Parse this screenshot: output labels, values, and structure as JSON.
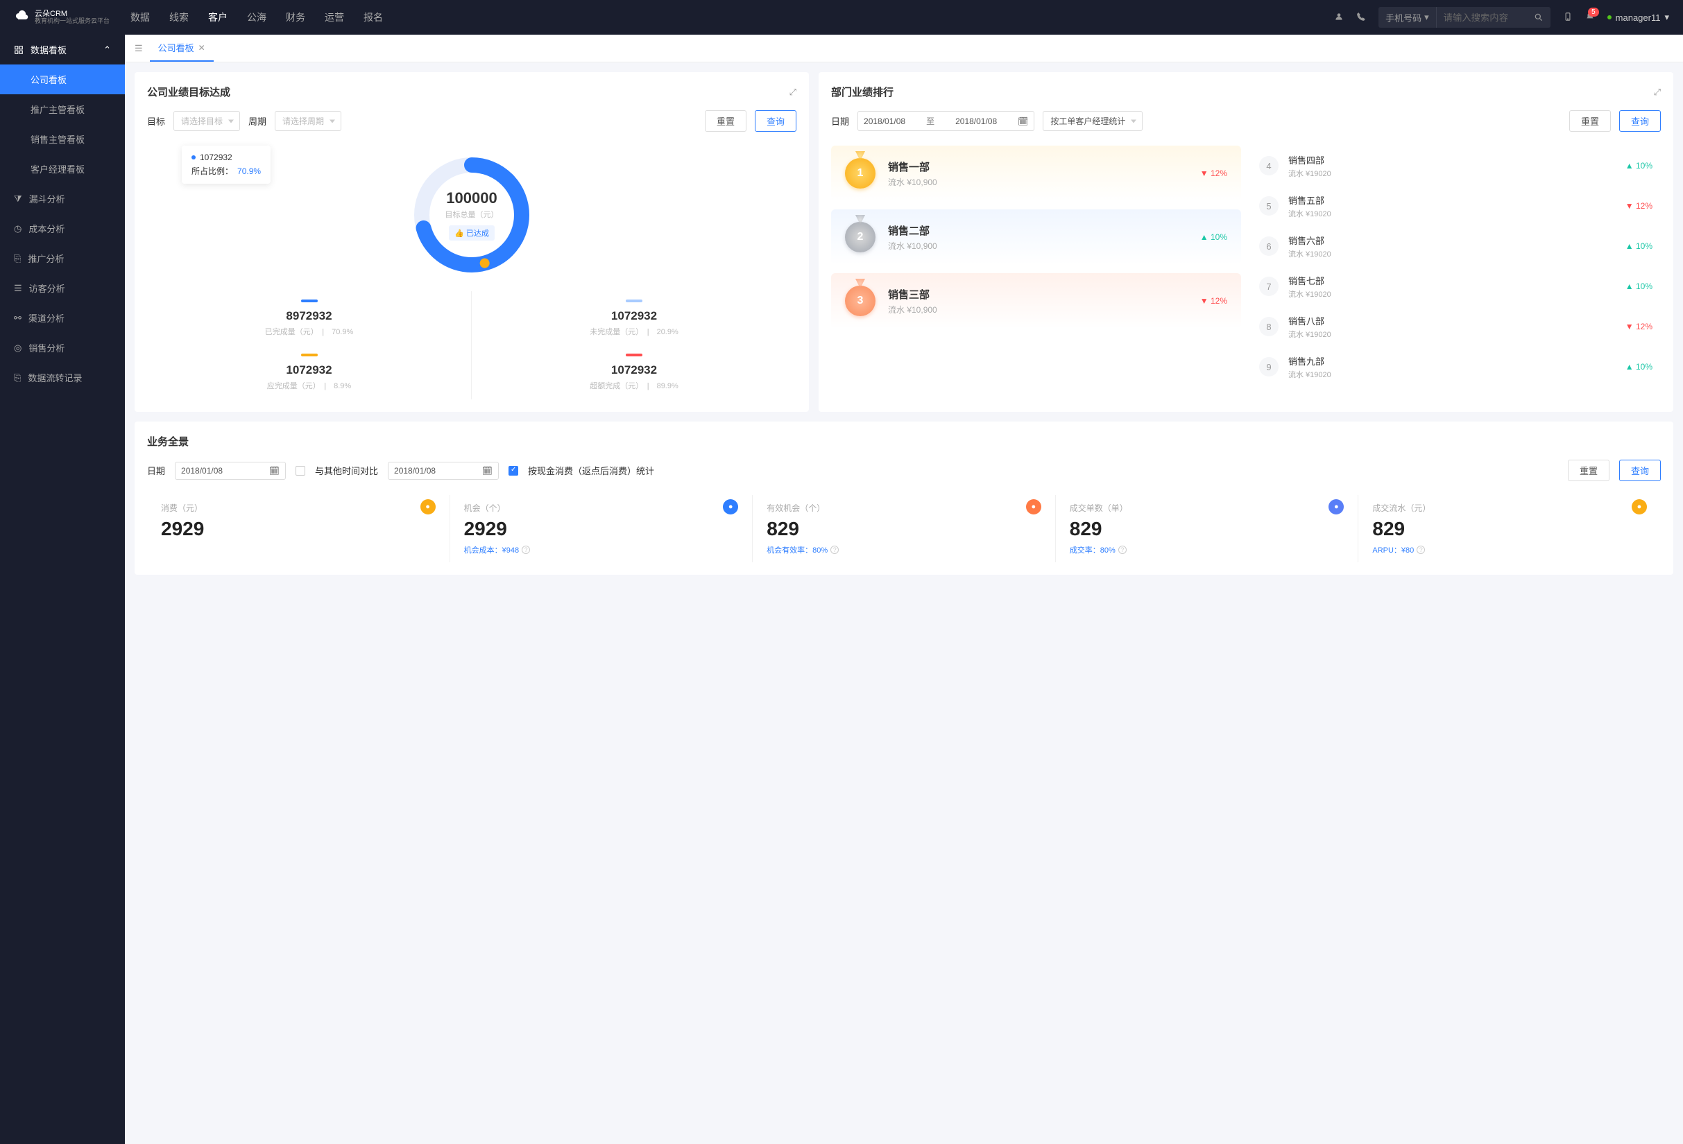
{
  "brand": {
    "name": "云朵CRM",
    "sub": "教育机构一站式服务云平台"
  },
  "topnav": {
    "items": [
      "数据",
      "线索",
      "客户",
      "公海",
      "财务",
      "运营",
      "报名"
    ],
    "active_index": 2
  },
  "search": {
    "type": "手机号码",
    "placeholder": "请输入搜索内容"
  },
  "notify_count": "5",
  "user": "manager11",
  "sidebar": {
    "group": "数据看板",
    "subs": [
      "公司看板",
      "推广主管看板",
      "销售主管看板",
      "客户经理看板"
    ],
    "active_sub": 0,
    "items": [
      "漏斗分析",
      "成本分析",
      "推广分析",
      "访客分析",
      "渠道分析",
      "销售分析",
      "数据流转记录"
    ]
  },
  "tab": {
    "title": "公司看板"
  },
  "goal": {
    "title": "公司业绩目标达成",
    "target_label": "目标",
    "target_placeholder": "请选择目标",
    "period_label": "周期",
    "period_placeholder": "请选择周期",
    "reset": "重置",
    "query": "查询",
    "center_value": "100000",
    "center_label": "目标总量（元）",
    "tag": "已达成",
    "tooltip_value": "1072932",
    "tooltip_label": "所占比例：",
    "tooltip_pct": "70.9%",
    "metrics": [
      {
        "bar": "#2e7eff",
        "val": "8972932",
        "label": "已完成量（元）",
        "pct": "70.9%"
      },
      {
        "bar": "#a8cbff",
        "val": "1072932",
        "label": "未完成量（元）",
        "pct": "20.9%"
      },
      {
        "bar": "#faad14",
        "val": "1072932",
        "label": "应完成量（元）",
        "pct": "8.9%"
      },
      {
        "bar": "#ff4d4f",
        "val": "1072932",
        "label": "超额完成（元）",
        "pct": "89.9%"
      }
    ]
  },
  "rank": {
    "title": "部门业绩排行",
    "date_label": "日期",
    "date_from": "2018/01/08",
    "date_sep": "至",
    "date_to": "2018/01/08",
    "mode": "按工单客户经理统计",
    "reset": "重置",
    "query": "查询",
    "top": [
      {
        "name": "销售一部",
        "sub": "流水 ¥10,900",
        "pct": "12%",
        "dir": "down"
      },
      {
        "name": "销售二部",
        "sub": "流水 ¥10,900",
        "pct": "10%",
        "dir": "up"
      },
      {
        "name": "销售三部",
        "sub": "流水 ¥10,900",
        "pct": "12%",
        "dir": "down"
      }
    ],
    "rest": [
      {
        "n": "4",
        "name": "销售四部",
        "sub": "流水 ¥19020",
        "pct": "10%",
        "dir": "up"
      },
      {
        "n": "5",
        "name": "销售五部",
        "sub": "流水 ¥19020",
        "pct": "12%",
        "dir": "down"
      },
      {
        "n": "6",
        "name": "销售六部",
        "sub": "流水 ¥19020",
        "pct": "10%",
        "dir": "up"
      },
      {
        "n": "7",
        "name": "销售七部",
        "sub": "流水 ¥19020",
        "pct": "10%",
        "dir": "up"
      },
      {
        "n": "8",
        "name": "销售八部",
        "sub": "流水 ¥19020",
        "pct": "12%",
        "dir": "down"
      },
      {
        "n": "9",
        "name": "销售九部",
        "sub": "流水 ¥19020",
        "pct": "10%",
        "dir": "up"
      }
    ]
  },
  "biz": {
    "title": "业务全景",
    "date_label": "日期",
    "date1": "2018/01/08",
    "compare_label": "与其他时间对比",
    "date2": "2018/01/08",
    "check_label": "按现金消费（返点后消费）统计",
    "reset": "重置",
    "query": "查询",
    "stats": [
      {
        "label": "消费（元）",
        "val": "2929",
        "sub": "",
        "icon": "si1"
      },
      {
        "label": "机会（个）",
        "val": "2929",
        "sub": "机会成本：¥948",
        "icon": "si2"
      },
      {
        "label": "有效机会（个）",
        "val": "829",
        "sub": "机会有效率：80%",
        "icon": "si3"
      },
      {
        "label": "成交单数（单）",
        "val": "829",
        "sub": "成交率：80%",
        "icon": "si4"
      },
      {
        "label": "成交流水（元）",
        "val": "829",
        "sub": "ARPU：¥80",
        "icon": "si5"
      }
    ]
  },
  "chart_data": {
    "type": "donut",
    "title": "公司业绩目标达成",
    "total": 100000,
    "total_label": "目标总量（元）",
    "series": [
      {
        "name": "已完成",
        "value": 1072932,
        "percent": 70.9,
        "color": "#2e7eff"
      }
    ]
  }
}
